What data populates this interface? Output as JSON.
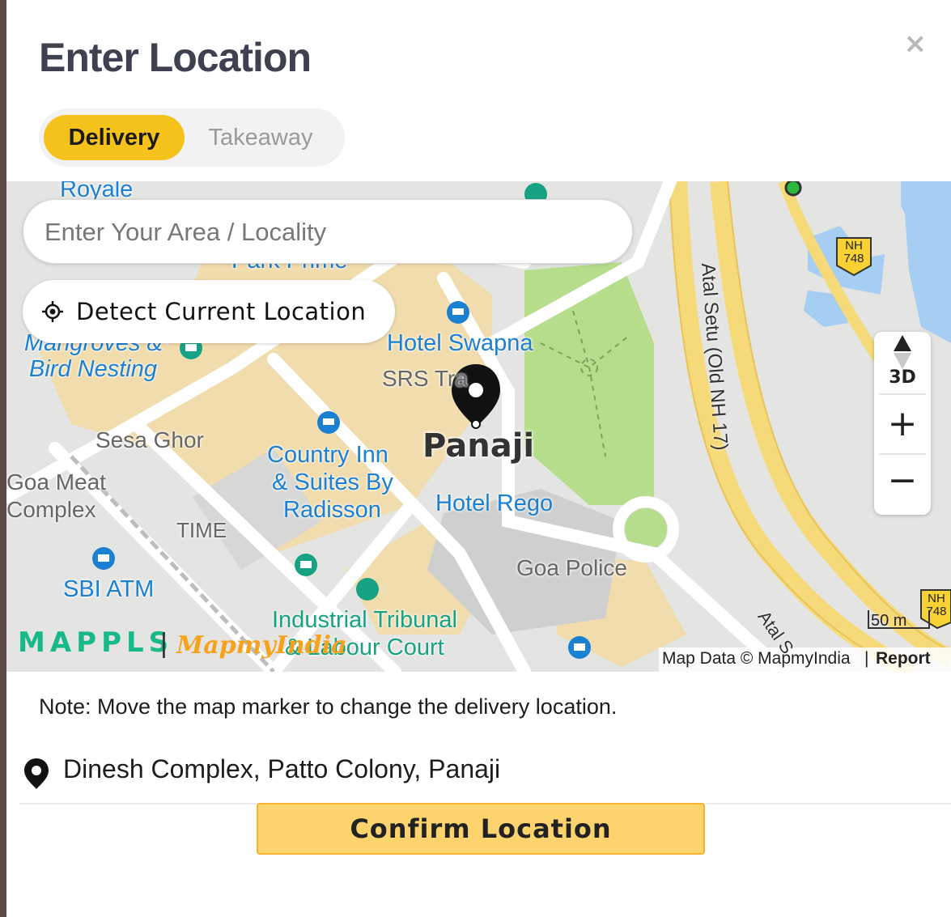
{
  "modal": {
    "title": "Enter Location",
    "close_label": "×"
  },
  "order_type": {
    "options": [
      "Delivery",
      "Takeaway"
    ],
    "selected": "Delivery"
  },
  "search": {
    "placeholder": "Enter Your Area / Locality",
    "value": ""
  },
  "detect": {
    "label": "Detect Current Location"
  },
  "map": {
    "labels": {
      "royale": "Royale",
      "park_prime": "Park Prime",
      "mangroves": "Mangroves &",
      "bird_nesting": "Bird Nesting",
      "hotel_swapna": "Hotel Swapna",
      "srs": "SRS Tra",
      "sesa_ghor": "Sesa Ghor",
      "country_inn_1": "Country Inn",
      "country_inn_2": "& Suites By",
      "country_inn_3": "Radisson",
      "panaji": "Panaji",
      "hotel_rego": "Hotel Rego",
      "goa_meat_1": "Goa Meat",
      "goa_meat_2": "Complex",
      "time": "TIME",
      "sbi_atm": "SBI ATM",
      "goa_police": "Goa Police",
      "tribunal_1": "Industrial Tribunal",
      "tribunal_2": "& Labour Court",
      "atal_setu": "Atal Setu (Old NH 17)",
      "atal_s": "Atal S",
      "nh748_a": "NH 748",
      "nh748_b": "NH 748"
    },
    "controls": {
      "three_d": "3D",
      "zoom_in": "+",
      "zoom_out": "−"
    },
    "scale": "50 m",
    "brand_mappls": "MAPPLS",
    "brand_mapmyindia": "MapmyIndia",
    "attribution": "Map Data © MapmyIndia",
    "report": "Report",
    "colors": {
      "road": "#ffffff",
      "highway": "#f6da7a",
      "park": "#b6dd8c",
      "water": "#a6cdf2",
      "block": "#f1dcad",
      "brand_green": "#17b88a",
      "brand_orange": "#f7a21d"
    }
  },
  "note": "Note: Move the map marker to change the delivery location.",
  "address": "Dinesh Complex, Patto Colony, Panaji",
  "confirm_label": "Confirm Location"
}
